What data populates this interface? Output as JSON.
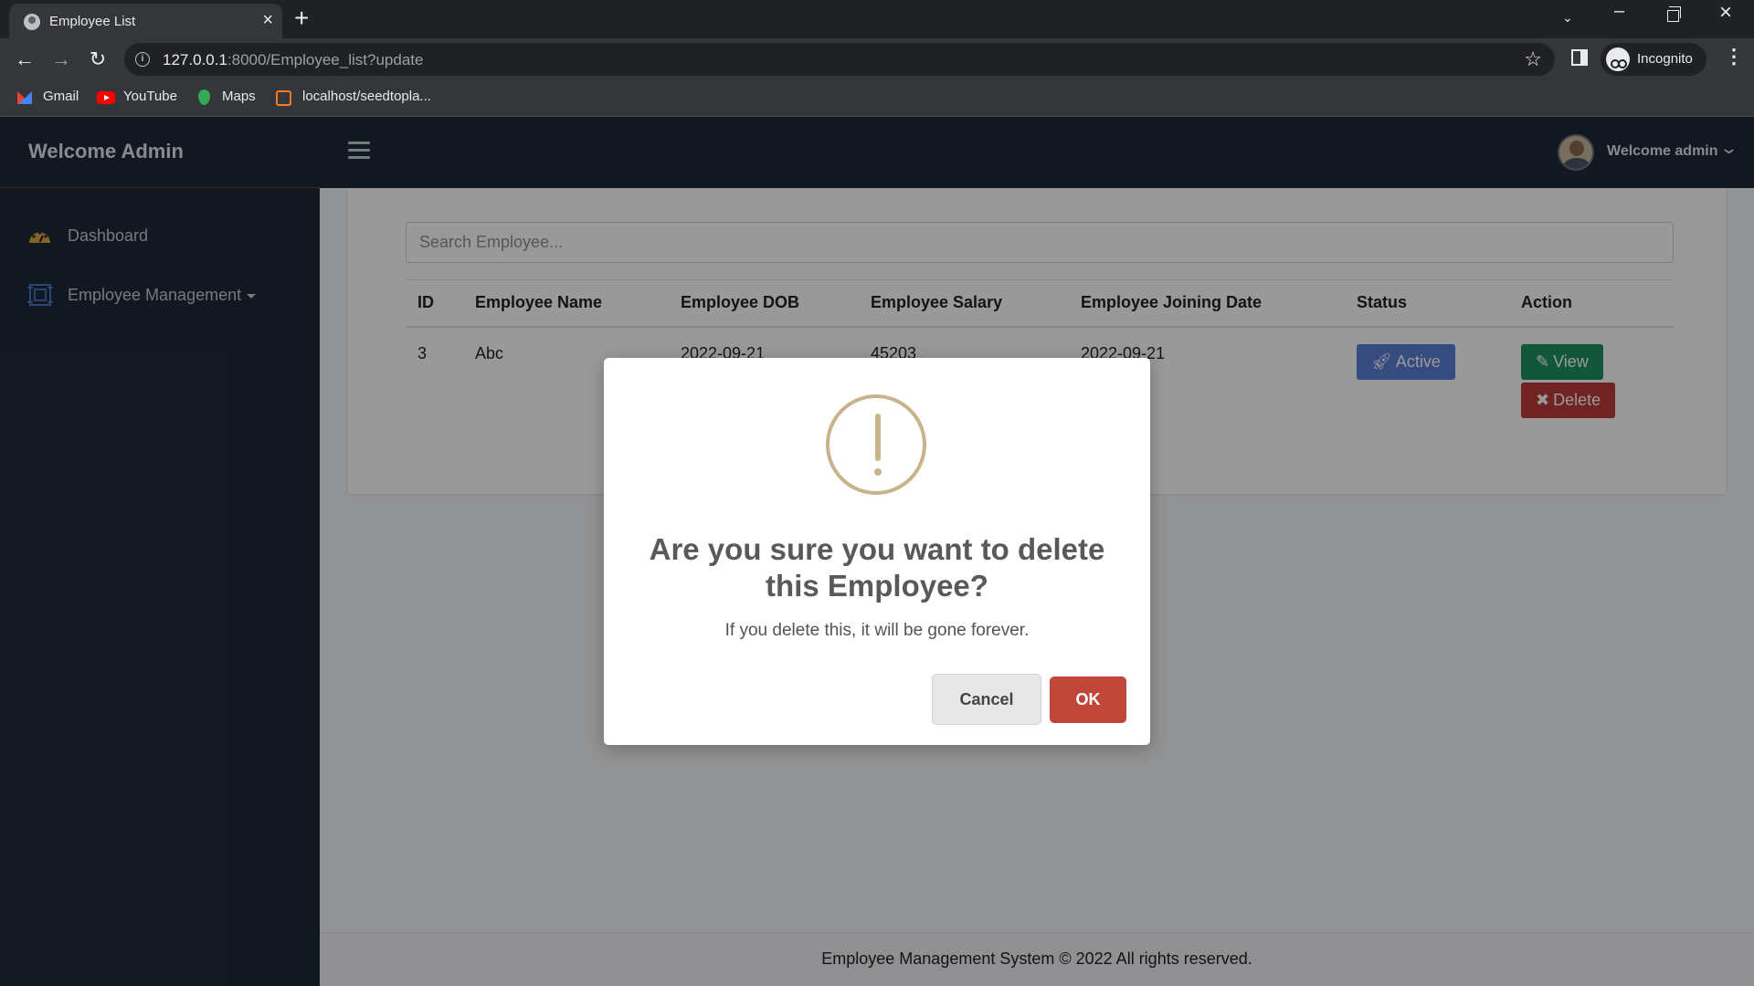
{
  "browser": {
    "tab_title": "Employee List",
    "url_host": "127.0.0.1",
    "url_rest": ":8000/Employee_list?update",
    "profile_label": "Incognito",
    "bookmarks": [
      "Gmail",
      "YouTube",
      "Maps",
      "localhost/seedtopla..."
    ]
  },
  "sidebar": {
    "brand": "Welcome Admin",
    "items": [
      {
        "label": "Dashboard",
        "icon": "dashboard-icon"
      },
      {
        "label": "Employee Management",
        "icon": "employee-management-icon"
      }
    ]
  },
  "topbar": {
    "user_label": "Welcome admin"
  },
  "main": {
    "search_placeholder": "Search Employee...",
    "table": {
      "columns": [
        "ID",
        "Employee Name",
        "Employee DOB",
        "Employee Salary",
        "Employee Joining Date",
        "Status",
        "Action"
      ],
      "rows": [
        {
          "id": "3",
          "name": "Abc",
          "dob": "2022-09-21",
          "salary": "45203",
          "joining_date": "2022-09-21",
          "status": "Active",
          "actions": [
            "View",
            "Delete"
          ]
        }
      ]
    }
  },
  "footer": {
    "text": "Employee Management System © 2022 All rights reserved."
  },
  "modal": {
    "title": "Are you sure you want to delete this Employee?",
    "text": "If you delete this, it will be gone forever.",
    "cancel_label": "Cancel",
    "ok_label": "OK"
  },
  "colors": {
    "sidebar_bg": "#1f2937",
    "active_button": "#5b7fd6",
    "view_button": "#1f8f64",
    "delete_button": "#bd3a3a",
    "ok_button": "#c0463a",
    "warning_icon": "#c8b48a"
  }
}
